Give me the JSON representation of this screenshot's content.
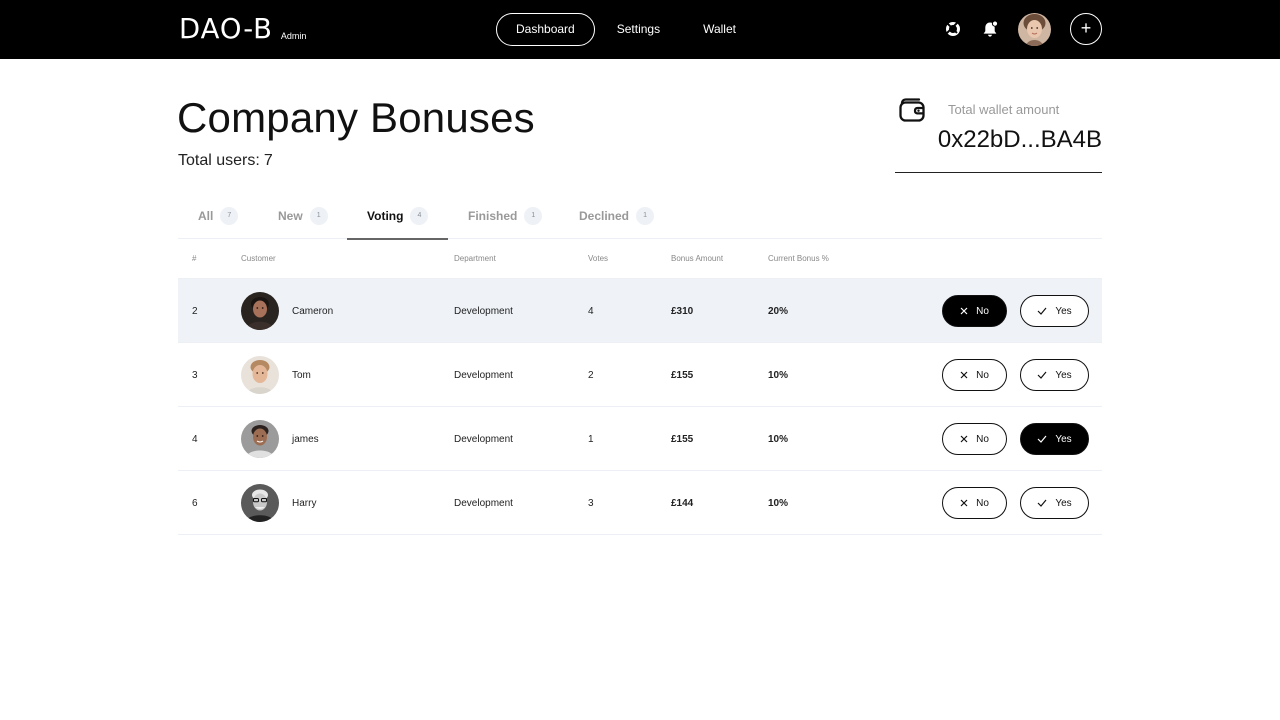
{
  "app": {
    "logo": "DAO-B",
    "logo_sub": "Admin"
  },
  "nav": {
    "items": [
      {
        "label": "Dashboard",
        "active": true
      },
      {
        "label": "Settings",
        "active": false
      },
      {
        "label": "Wallet",
        "active": false
      }
    ]
  },
  "header_icons": [
    "lifebuoy-icon",
    "notification-bell-icon",
    "user-avatar",
    "plus-icon"
  ],
  "page": {
    "title": "Company Bonuses",
    "total_users_label": "Total users:",
    "total_users_value": "7"
  },
  "wallet": {
    "label": "Total wallet amount",
    "value": "0x22bD...BA4B"
  },
  "tabs": [
    {
      "label": "All",
      "count": "7",
      "active": false
    },
    {
      "label": "New",
      "count": "1",
      "active": false
    },
    {
      "label": "Voting",
      "count": "4",
      "active": true
    },
    {
      "label": "Finished",
      "count": "1",
      "active": false
    },
    {
      "label": "Declined",
      "count": "1",
      "active": false
    }
  ],
  "table": {
    "headers": [
      "#",
      "Customer",
      "Department",
      "Votes",
      "Bonus Amount",
      "Current Bonus %"
    ],
    "rows": [
      {
        "id": "2",
        "name": "Cameron",
        "department": "Development",
        "votes": "4",
        "bonus": "£310",
        "percent": "20%",
        "vote": "no",
        "highlight": true
      },
      {
        "id": "3",
        "name": "Tom",
        "department": "Development",
        "votes": "2",
        "bonus": "£155",
        "percent": "10%",
        "vote": "none",
        "highlight": false
      },
      {
        "id": "4",
        "name": "james",
        "department": "Development",
        "votes": "1",
        "bonus": "£155",
        "percent": "10%",
        "vote": "yes",
        "highlight": false
      },
      {
        "id": "6",
        "name": "Harry",
        "department": "Development",
        "votes": "3",
        "bonus": "£144",
        "percent": "10%",
        "vote": "none",
        "highlight": false
      }
    ],
    "no_label": "No",
    "yes_label": "Yes"
  },
  "colors": {
    "topbar": "#000000",
    "row_highlight": "#eff3f8",
    "accent": "#000000"
  }
}
